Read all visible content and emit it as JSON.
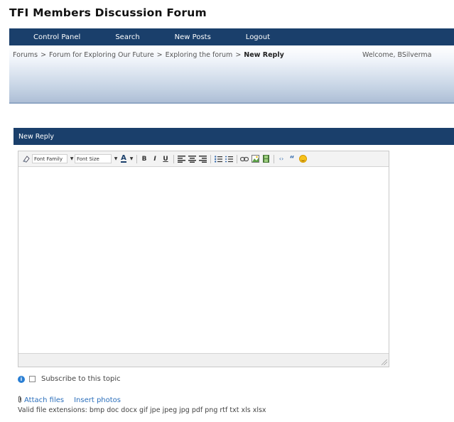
{
  "site_title": "TFI Members Discussion Forum",
  "nav": {
    "items": [
      "Control Panel",
      "Search",
      "New Posts",
      "Logout"
    ]
  },
  "breadcrumb": {
    "items": [
      "Forums",
      "Forum for Exploring Our Future",
      "Exploring the forum"
    ],
    "separator": ">",
    "current": "New Reply"
  },
  "welcome": "Welcome, BSilverma",
  "panel": {
    "title": "New Reply"
  },
  "toolbar": {
    "font_family": "Font Family",
    "font_size": "Font Size",
    "color_letter": "A",
    "bold": "B",
    "italic": "I",
    "underline": "U"
  },
  "subscribe": {
    "label": "Subscribe to this topic",
    "checked": false
  },
  "attachments": {
    "attach_label": "Attach files",
    "insert_label": "Insert photos",
    "valid_extensions": "Valid file extensions: bmp doc docx gif jpe jpeg jpg pdf png rtf txt xls xlsx"
  },
  "colors": {
    "nav_bg": "#1a3f6b",
    "link": "#2a6ebb",
    "info_icon": "#2a7fd4"
  }
}
